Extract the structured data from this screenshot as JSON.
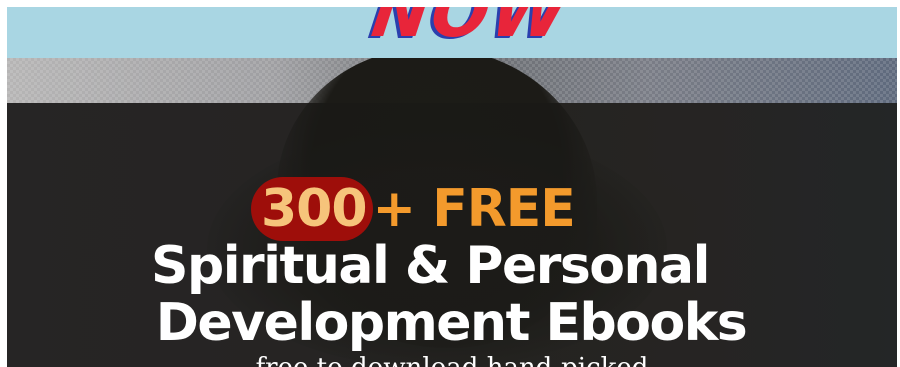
{
  "banner": {
    "word": "NOW",
    "background": "#a9d6e3",
    "word_color": "#e8253a",
    "word_shadow_color": "#2a3fae"
  },
  "hero": {
    "count_label": "300",
    "free_label": "+ FREE",
    "line2": "Spiritual & Personal",
    "line3": "Development Ebooks",
    "subline": "free to download hand-picked",
    "pill_color": "#9e0e0a",
    "count_color": "#f6c47b",
    "free_color": "#f39a2c",
    "text_color": "#ffffff"
  }
}
